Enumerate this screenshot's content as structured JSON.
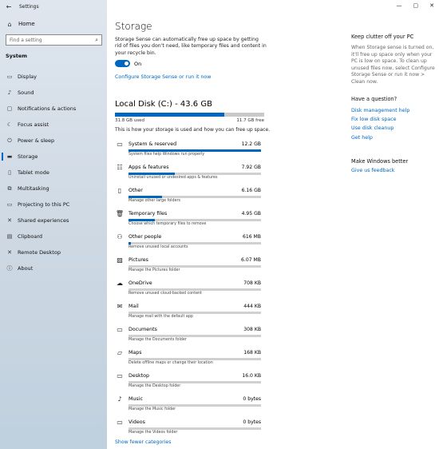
{
  "window": {
    "title": "Settings"
  },
  "sidebar": {
    "home_label": "Home",
    "search_placeholder": "Find a setting",
    "group_label": "System",
    "items": [
      {
        "label": "Display",
        "icon": "display-icon",
        "glyph": "▭"
      },
      {
        "label": "Sound",
        "icon": "sound-icon",
        "glyph": "♪"
      },
      {
        "label": "Notifications & actions",
        "icon": "notifications-icon",
        "glyph": "▢"
      },
      {
        "label": "Focus assist",
        "icon": "moon-icon",
        "glyph": "☾"
      },
      {
        "label": "Power & sleep",
        "icon": "power-icon",
        "glyph": "⏻"
      },
      {
        "label": "Storage",
        "icon": "storage-icon",
        "glyph": "▬",
        "active": true
      },
      {
        "label": "Tablet mode",
        "icon": "tablet-icon",
        "glyph": "▯"
      },
      {
        "label": "Multitasking",
        "icon": "multitasking-icon",
        "glyph": "⧉"
      },
      {
        "label": "Projecting to this PC",
        "icon": "projecting-icon",
        "glyph": "▭"
      },
      {
        "label": "Shared experiences",
        "icon": "shared-icon",
        "glyph": "✕"
      },
      {
        "label": "Clipboard",
        "icon": "clipboard-icon",
        "glyph": "▤"
      },
      {
        "label": "Remote Desktop",
        "icon": "remote-desktop-icon",
        "glyph": "✕"
      },
      {
        "label": "About",
        "icon": "info-icon",
        "glyph": "ⓘ"
      }
    ]
  },
  "main": {
    "title": "Storage",
    "description": "Storage Sense can automatically free up space by getting rid of files you don't need, like temporary files and content in your recycle bin.",
    "toggle_label": "On",
    "toggle_on": true,
    "config_link": "Configure Storage Sense or run it now",
    "disk": {
      "title": "Local Disk (C:) - 43.6 GB",
      "used_label": "31.8 GB used",
      "free_label": "11.7 GB free",
      "used_fraction": 0.73
    },
    "how_text": "This is how your storage is used and how you can free up space.",
    "categories": [
      {
        "name": "System & reserved",
        "size": "12.2 GB",
        "sub": "System files help Windows run properly",
        "fraction": 1.0,
        "icon": "monitor-icon",
        "glyph": "▭"
      },
      {
        "name": "Apps & features",
        "size": "7.92 GB",
        "sub": "Uninstall unused or undesired apps & features",
        "fraction": 0.35,
        "icon": "apps-icon",
        "glyph": "☷"
      },
      {
        "name": "Other",
        "size": "6.16 GB",
        "sub": "Manage other large folders",
        "fraction": 0.25,
        "icon": "document-icon",
        "glyph": "▯"
      },
      {
        "name": "Temporary files",
        "size": "4.95 GB",
        "sub": "Choose which temporary files to remove",
        "fraction": 0.2,
        "icon": "trash-icon",
        "glyph": "🗑"
      },
      {
        "name": "Other people",
        "size": "616 MB",
        "sub": "Remove unused local accounts",
        "fraction": 0.02,
        "icon": "people-icon",
        "glyph": "⚇"
      },
      {
        "name": "Pictures",
        "size": "6.07 MB",
        "sub": "Manage the Pictures folder",
        "fraction": 0,
        "icon": "pictures-icon",
        "glyph": "▨"
      },
      {
        "name": "OneDrive",
        "size": "708 KB",
        "sub": "Remove unused cloud-backed content",
        "fraction": 0,
        "icon": "cloud-icon",
        "glyph": "☁"
      },
      {
        "name": "Mail",
        "size": "444 KB",
        "sub": "Manage mail with the default app",
        "fraction": 0,
        "icon": "mail-icon",
        "glyph": "✉"
      },
      {
        "name": "Documents",
        "size": "308 KB",
        "sub": "Manage the Documents folder",
        "fraction": 0,
        "icon": "folder-icon",
        "glyph": "▭"
      },
      {
        "name": "Maps",
        "size": "168 KB",
        "sub": "Delete offline maps or change their location",
        "fraction": 0,
        "icon": "map-icon",
        "glyph": "▱"
      },
      {
        "name": "Desktop",
        "size": "16.0 KB",
        "sub": "Manage the Desktop folder",
        "fraction": 0,
        "icon": "desktop-icon",
        "glyph": "▭"
      },
      {
        "name": "Music",
        "size": "0 bytes",
        "sub": "Manage the Music folder",
        "fraction": 0,
        "icon": "music-icon",
        "glyph": "♪"
      },
      {
        "name": "Videos",
        "size": "0 bytes",
        "sub": "Manage the Videos folder",
        "fraction": 0,
        "icon": "video-icon",
        "glyph": "▭"
      }
    ],
    "fewer_link": "Show fewer categories"
  },
  "right": {
    "clutter_heading": "Keep clutter off your PC",
    "clutter_text": "When Storage sense is turned on, it'll free up space only when your PC is low on space. To clean up unused files now, select Configure Storage Sense or run it now > Clean now.",
    "question_heading": "Have a question?",
    "question_links": [
      "Disk management help",
      "Fix low disk space",
      "Use disk cleanup",
      "Get help"
    ],
    "better_heading": "Make Windows better",
    "feedback_link": "Give us feedback"
  },
  "colors": {
    "accent": "#0067c0",
    "sidebar_top": "#dfe6ee",
    "sidebar_bottom": "#bfd0de"
  }
}
